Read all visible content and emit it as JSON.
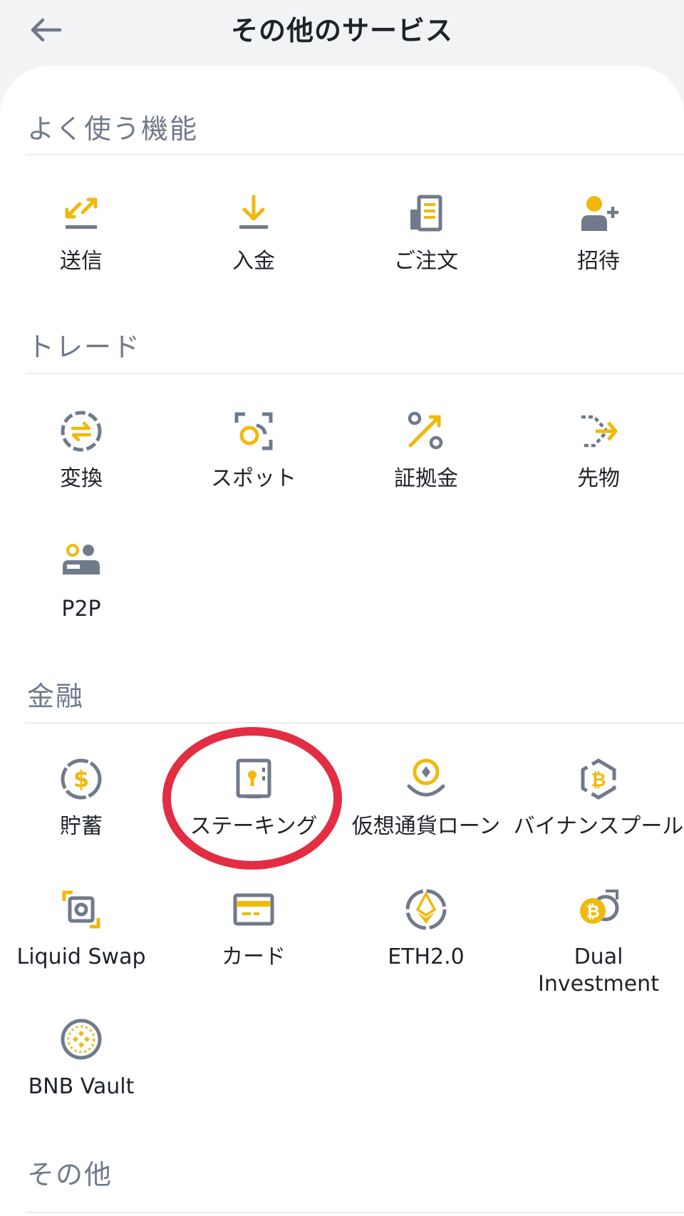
{
  "header": {
    "title": "その他のサービス"
  },
  "sections": [
    {
      "title": "よく使う機能",
      "items": [
        {
          "label": "送信",
          "icon": "send-icon"
        },
        {
          "label": "入金",
          "icon": "deposit-icon"
        },
        {
          "label": "ご注文",
          "icon": "orders-icon"
        },
        {
          "label": "招待",
          "icon": "invite-icon"
        }
      ]
    },
    {
      "title": "トレード",
      "items": [
        {
          "label": "変換",
          "icon": "convert-icon"
        },
        {
          "label": "スポット",
          "icon": "spot-icon"
        },
        {
          "label": "証拠金",
          "icon": "margin-icon"
        },
        {
          "label": "先物",
          "icon": "futures-icon"
        },
        {
          "label": "P2P",
          "icon": "p2p-icon"
        }
      ]
    },
    {
      "title": "金融",
      "items": [
        {
          "label": "貯蓄",
          "icon": "savings-icon"
        },
        {
          "label": "ステーキング",
          "icon": "staking-icon"
        },
        {
          "label": "仮想通貨ローン",
          "icon": "crypto-loan-icon"
        },
        {
          "label": "バイナンスプール",
          "icon": "binance-pool-icon"
        },
        {
          "label": "Liquid Swap",
          "icon": "liquid-swap-icon"
        },
        {
          "label": "カード",
          "icon": "card-icon"
        },
        {
          "label": "ETH2.0",
          "icon": "eth2-icon"
        },
        {
          "label": "Dual Investment",
          "icon": "dual-investment-icon"
        },
        {
          "label": "BNB Vault",
          "icon": "bnb-vault-icon"
        }
      ]
    },
    {
      "title": "その他",
      "items": []
    }
  ],
  "colors": {
    "accent": "#f0b90b",
    "icon_gray": "#707a8a",
    "highlight": "#e22d43"
  }
}
